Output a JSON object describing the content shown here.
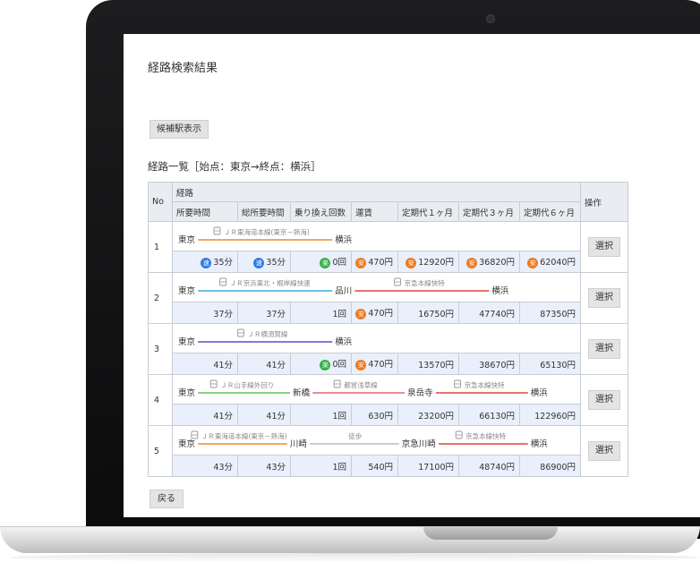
{
  "page": {
    "title": "経路検索結果",
    "candidate_button": "候補駅表示",
    "list_title": "経路一覧［始点：東京→終点：横浜］",
    "back_button": "戻る"
  },
  "table": {
    "header": {
      "no": "No",
      "route": "経路",
      "operation": "操作",
      "required_time": "所要時間",
      "total_time": "総所要時間",
      "transfers": "乗り換え回数",
      "fare": "運賃",
      "commuter_1m": "定期代１ヶ月",
      "commuter_3m": "定期代３ヶ月",
      "commuter_6m": "定期代６ヶ月"
    },
    "select_label": "選択",
    "badges": {
      "fast": "速",
      "easy": "楽",
      "cheap": "安"
    },
    "colors": {
      "fast": "#2f7be6",
      "easy": "#39b04a",
      "cheap": "#f07a1e",
      "value_row_bg": "#eaf0fb"
    },
    "rows": [
      {
        "no": "1",
        "route": {
          "stations": [
            "東京",
            "横浜"
          ],
          "lines": [
            {
              "name": "ＪＲ東海道本線(東京－熱海)",
              "color": "#f08a2c",
              "icon": "train-icon"
            }
          ]
        },
        "time": "35分",
        "time_badge": "fast",
        "total": "35分",
        "total_badge": "fast",
        "transfers": "0回",
        "transfers_badge": "easy",
        "fare": "470円",
        "fare_badge": "cheap",
        "c1": "12920円",
        "c1_badge": "cheap",
        "c3": "36820円",
        "c3_badge": "cheap",
        "c6": "62040円",
        "c6_badge": "cheap"
      },
      {
        "no": "2",
        "route": {
          "stations": [
            "東京",
            "品川",
            "横浜"
          ],
          "lines": [
            {
              "name": "ＪＲ京浜東北・根岸線快速",
              "color": "#3aaee0",
              "icon": "train-icon"
            },
            {
              "name": "京急本線快特",
              "color": "#e2453c",
              "icon": "train-icon"
            }
          ]
        },
        "time": "37分",
        "total": "37分",
        "transfers": "1回",
        "fare": "470円",
        "fare_badge": "cheap",
        "c1": "16750円",
        "c3": "47740円",
        "c6": "87350円"
      },
      {
        "no": "3",
        "route": {
          "stations": [
            "東京",
            "横浜"
          ],
          "lines": [
            {
              "name": "ＪＲ横須賀線",
              "color": "#5a4fc9",
              "icon": "train-icon"
            }
          ]
        },
        "time": "41分",
        "total": "41分",
        "transfers": "0回",
        "transfers_badge": "easy",
        "fare": "470円",
        "fare_badge": "cheap",
        "c1": "13570円",
        "c3": "38670円",
        "c6": "65130円"
      },
      {
        "no": "4",
        "route": {
          "stations": [
            "東京",
            "新橋",
            "泉岳寺",
            "横浜"
          ],
          "lines": [
            {
              "name": "ＪＲ山手線外回り",
              "color": "#5cc45a",
              "icon": "train-icon"
            },
            {
              "name": "都営浅草線",
              "color": "#e7627a",
              "icon": "train-icon"
            },
            {
              "name": "京急本線快特",
              "color": "#e2453c",
              "icon": "train-icon"
            }
          ]
        },
        "time": "41分",
        "total": "41分",
        "transfers": "1回",
        "fare": "630円",
        "c1": "23200円",
        "c3": "66130円",
        "c6": "122960円"
      },
      {
        "no": "5",
        "route": {
          "stations": [
            "東京",
            "川崎",
            "京急川崎",
            "横浜"
          ],
          "lines": [
            {
              "name": "ＪＲ東海道本線(東京－熱海)",
              "color": "#f08a2c",
              "icon": "train-icon"
            },
            {
              "name": "徒歩",
              "color": "#bbbbbb",
              "icon": ""
            },
            {
              "name": "京急本線快特",
              "color": "#e2453c",
              "icon": "train-icon"
            }
          ]
        },
        "time": "43分",
        "total": "43分",
        "transfers": "1回",
        "fare": "540円",
        "c1": "17100円",
        "c3": "48740円",
        "c6": "86900円"
      }
    ]
  }
}
